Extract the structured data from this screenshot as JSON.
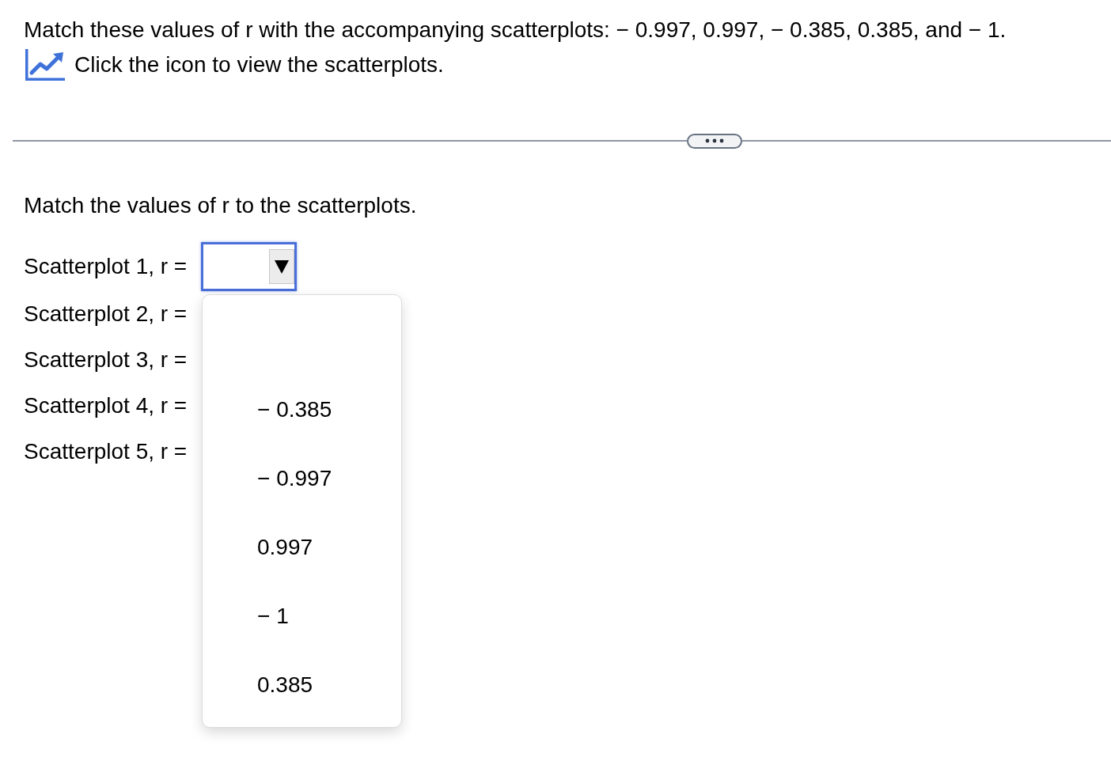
{
  "question": {
    "text": "Match these values of r with the accompanying scatterplots: − 0.997, 0.997, − 0.385, 0.385, and − 1.",
    "icon_hint": "Click the icon to view the scatterplots."
  },
  "prompt": "Match the values of r to the scatterplots.",
  "rows": [
    {
      "label": "Scatterplot 1, r =",
      "dropdown": {
        "expanded": true,
        "options": [
          "− 0.385",
          "− 0.997",
          "0.997",
          "− 1",
          "0.385"
        ]
      }
    },
    {
      "label": "Scatterplot 2, r ="
    },
    {
      "label": "Scatterplot 3, r ="
    },
    {
      "label": "Scatterplot 4, r ="
    },
    {
      "label": "Scatterplot 5, r ="
    }
  ]
}
